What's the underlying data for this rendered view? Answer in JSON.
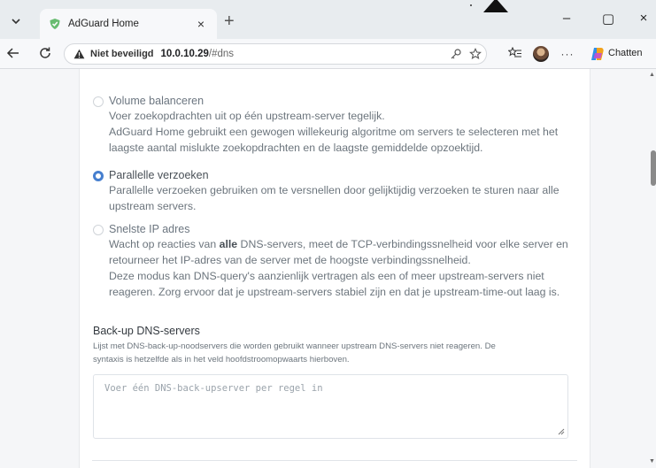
{
  "browser": {
    "tab_title": "AdGuard Home",
    "tab_close": "×",
    "new_tab": "+",
    "window_controls": {
      "minimize": "–",
      "maximize": "▢",
      "close": "×"
    },
    "address": {
      "security_label": "Niet beveiligd",
      "host": "10.0.10.29",
      "path": "/#dns"
    },
    "chat_label": "Chatten",
    "icons": [
      "tab-dropdown-icon",
      "adguard-shield-icon",
      "back-icon",
      "reload-icon",
      "warning-icon",
      "key-icon",
      "star-icon",
      "favorites-icon",
      "profile-avatar",
      "more-icon",
      "copilot-icon"
    ]
  },
  "dns": {
    "modes": [
      {
        "title": "Volume balanceren",
        "selected": false,
        "lines": [
          "Voer zoekopdrachten uit op één upstream-server tegelijk.",
          "AdGuard Home gebruikt een gewogen willekeurig algoritme om servers te selecteren met het",
          "laagste aantal mislukte zoekopdrachten en de laagste gemiddelde opzoektijd."
        ]
      },
      {
        "title": "Parallelle verzoeken",
        "selected": true,
        "lines": [
          "Parallelle verzoeken gebruiken om te versnellen door gelijktijdig verzoeken te sturen naar alle",
          "upstream servers."
        ]
      },
      {
        "title": "Snelste IP adres",
        "selected": false,
        "line1_pre": "Wacht op reacties van ",
        "line1_bold": "alle",
        "line1_post": " DNS-servers, meet de TCP-verbindingssnelheid voor elke server en",
        "lines": [
          "retourneer het IP-adres van de server met de hoogste verbindingssnelheid.",
          "Deze modus kan DNS-query's aanzienlijk vertragen als een of meer upstream-servers niet",
          "reageren. Zorg ervoor dat je upstream-servers stabiel zijn en dat je upstream-time-out laag is."
        ]
      }
    ],
    "backup": {
      "title": "Back-up DNS-servers",
      "desc_lines": [
        "Lijst met DNS-back-up-noodservers die worden gebruikt wanneer upstream DNS-servers niet reageren. De",
        "syntaxis is hetzelfde als in het veld hoofdstroomopwaarts hierboven."
      ],
      "placeholder": "Voer één DNS-back-upserver per regel in"
    }
  },
  "colors": {
    "accent": "#467fcf",
    "tab_strip": "#e8ecef",
    "shield": "#68bc71"
  }
}
